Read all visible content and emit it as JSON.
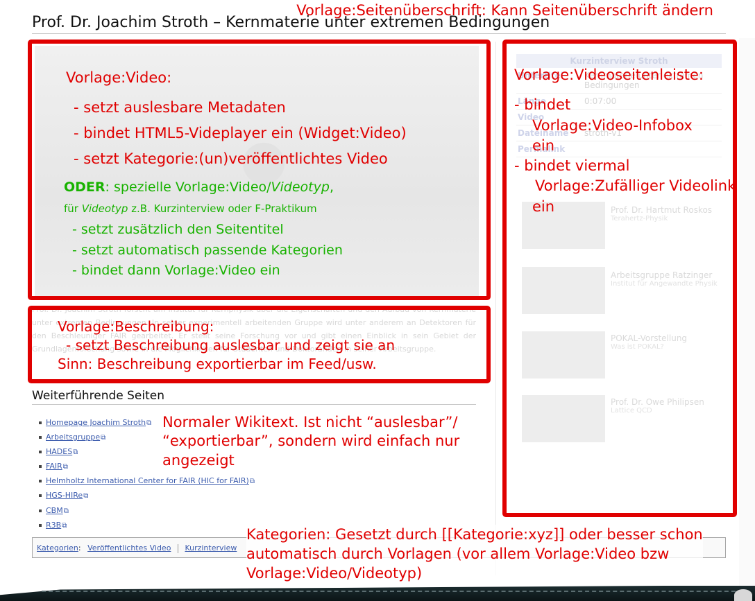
{
  "page": {
    "title": "Prof. Dr. Joachim Stroth – Kernmaterie unter extremen Bedingungen"
  },
  "annotations": {
    "title_template": "Vorlage:Seitenüberschrift: Kann Seitenüberschrift ändern",
    "video": {
      "heading": "Vorlage:Video:",
      "items": [
        "-  setzt auslesbare Metadaten",
        "-  bindet HTML5-Videplayer ein (Widget:Video)",
        "-  setzt Kategorie:(un)veröffentlichtes Video"
      ],
      "oder_bold": "ODER",
      "oder_text": ": spezielle Vorlage:Video/",
      "oder_italic": "Videotyp",
      "oder_end": ",",
      "fuer_text": "für ",
      "fuer_italic": "Videotyp",
      "fuer_end": " z.B. Kurzinterview oder F-Praktikum",
      "green_items": [
        "-  setzt zusätzlich den Seitentitel",
        "-  setzt automatisch passende Kategorien",
        "-  bindet dann Vorlage:Video ein"
      ]
    },
    "description": {
      "line1": "Vorlage:Beschreibung:",
      "line2": "-  setzt Beschreibung auslesbar und zeigt sie an",
      "line3": "Sinn: Beschreibung exportierbar im Feed/usw."
    },
    "sidebar": {
      "lines": [
        "Vorlage:Videoseitenleiste:",
        "",
        "- bindet",
        "  Vorlage:Video-Infobox",
        "  ein",
        "- bindet viermal",
        "   Vorlage:Zufälliger Videolink",
        "  ein"
      ]
    },
    "wikitext": {
      "line1": "Normaler Wikitext. Ist nicht “auslesbar”/",
      "line2": "“exportierbar”, sondern wird einfach nur",
      "line3": "angezeigt"
    },
    "categories": {
      "line1": "Kategorien: Gesetzt durch [[Kategorie:xyz]] oder besser schon",
      "line2": "automatisch durch Vorlagen (vor allem Vorlage:Video bzw",
      "line3": "Vorlage:Video/Videotyp)"
    }
  },
  "description_text": "Prof. Dr. Joachim Stroth forscht am Institut für Kernphysik über die Eigenschaften und den Aufbau von Kernmaterie unter extremen Bedingungen. In seiner experimentell arbeitenden Gruppe wird unter anderem an Detektoren für den Beschleuniger FAIR gearbeitet. Er stellt seine Forschung vor und gibt einen Einblick in sein Gebiet der Grundlagenforschung sowie in die Möglichkeiten für Studenten und Doktoranden in seiner Arbeitsgruppe.",
  "sidebar": {
    "infobox_title": "Kurzinterview Stroth",
    "rows": [
      {
        "key": "Untertitel",
        "value": "Kernmaterie unter extremen Bedingungen"
      },
      {
        "key": "Länge",
        "value": "0:07:00"
      },
      {
        "key": "Video",
        "value": ""
      },
      {
        "key": "Dateiname",
        "value": "stroth-v1"
      },
      {
        "key": "Permalink",
        "value": ""
      }
    ],
    "related": [
      {
        "name": "Prof. Dr. Hartmut Roskos",
        "sub": "Terahertz-Physik"
      },
      {
        "name": "Arbeitsgruppe Ratzinger",
        "sub": "Institut für Angewandte Physik"
      },
      {
        "name": "POKAL-Vorstellung",
        "sub": "Was ist POKAL?"
      },
      {
        "name": "Prof. Dr. Owe Philipsen",
        "sub": "Lattice QCD"
      }
    ]
  },
  "further": {
    "title": "Weiterführende Seiten",
    "links": [
      "Homepage Joachim Stroth",
      "Arbeitsgruppe",
      "HADES",
      "FAIR",
      "Helmholtz International Center for FAIR (HIC for FAIR)",
      "HGS-HIRe",
      "CBM",
      "R3B"
    ]
  },
  "category_bar": {
    "label": "Kategorien",
    "colon": ":",
    "items": [
      "Veröffentlichtes Video",
      "Kurzinterview"
    ]
  },
  "colors": {
    "annotation_red": "#e00000",
    "annotation_green": "#18b200",
    "link_blue": "#3b5bad"
  }
}
